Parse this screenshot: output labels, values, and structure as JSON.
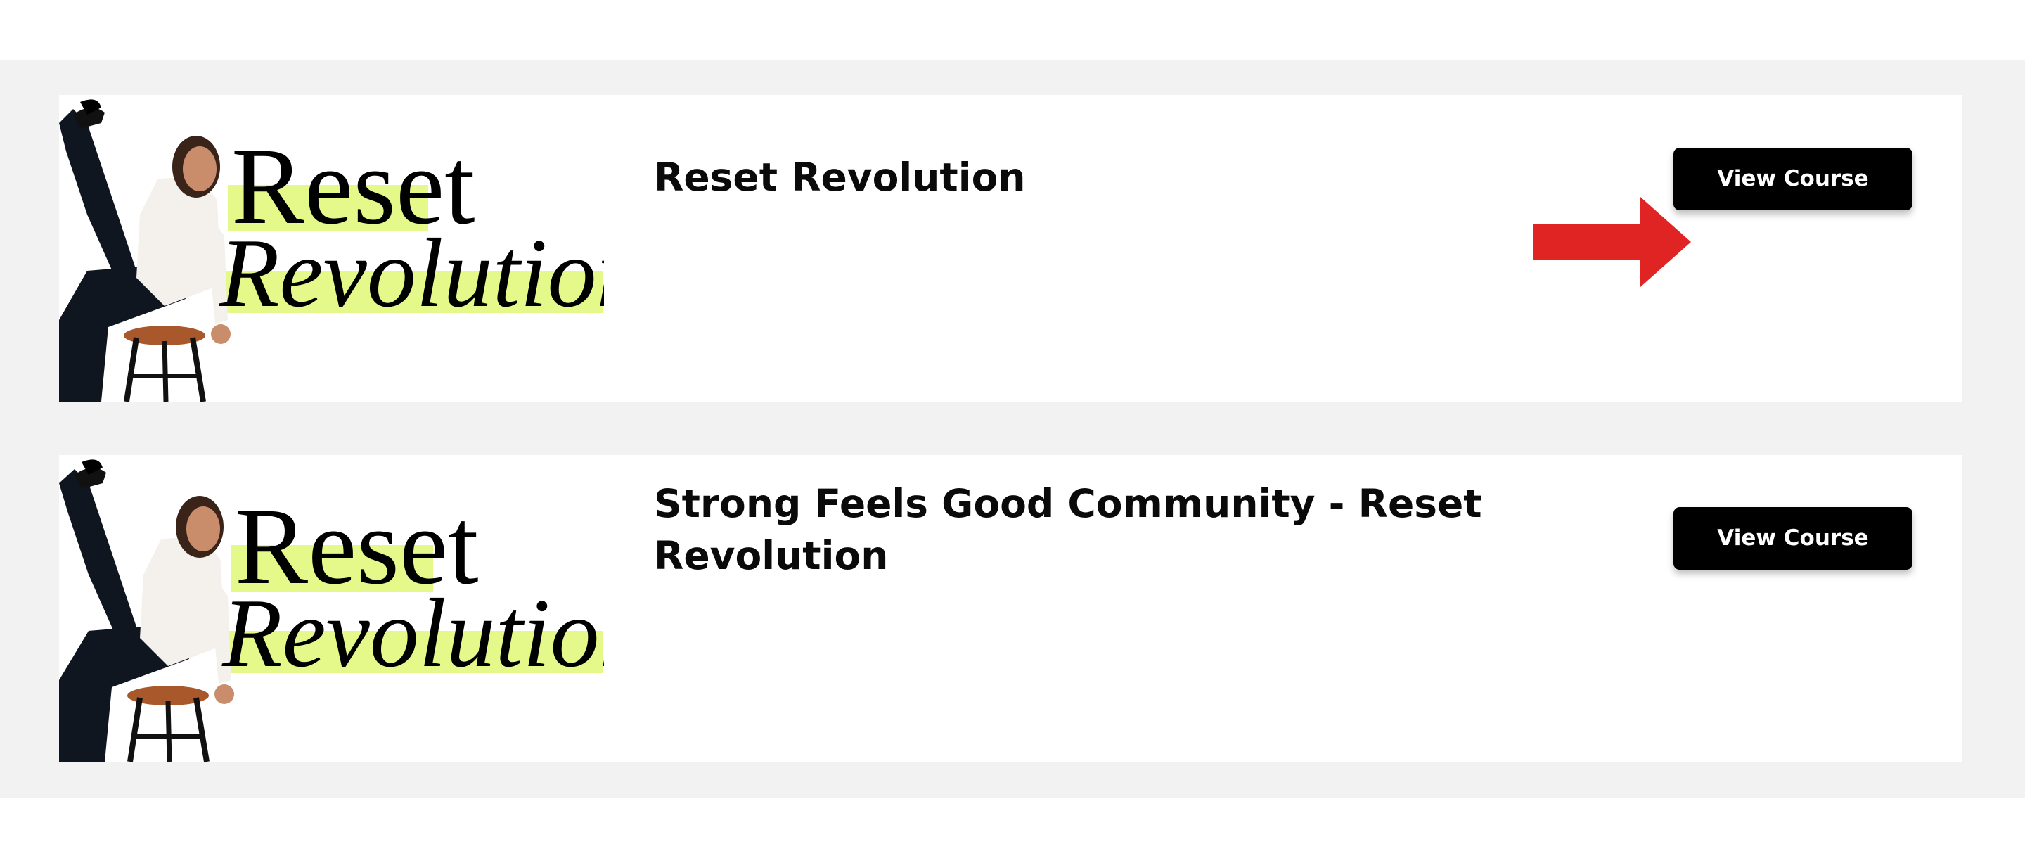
{
  "colors": {
    "page_background": "#ffffff",
    "section_background": "#f2f2f2",
    "card_background": "#ffffff",
    "button_background": "#000000",
    "button_text": "#ffffff",
    "highlight": "#e4f98a",
    "arrow": "#e02424"
  },
  "courses": [
    {
      "title": "Reset Revolution",
      "button_label": "View Course",
      "thumbnail": {
        "line1": "Reset",
        "line2": "Revolution"
      }
    },
    {
      "title": "Strong Feels Good Community - Reset Revolution",
      "button_label": "View Course",
      "thumbnail": {
        "line1": "Reset",
        "line2": "Revolution"
      }
    }
  ],
  "annotation": {
    "icon": "arrow-right-icon",
    "color": "#e02424"
  }
}
